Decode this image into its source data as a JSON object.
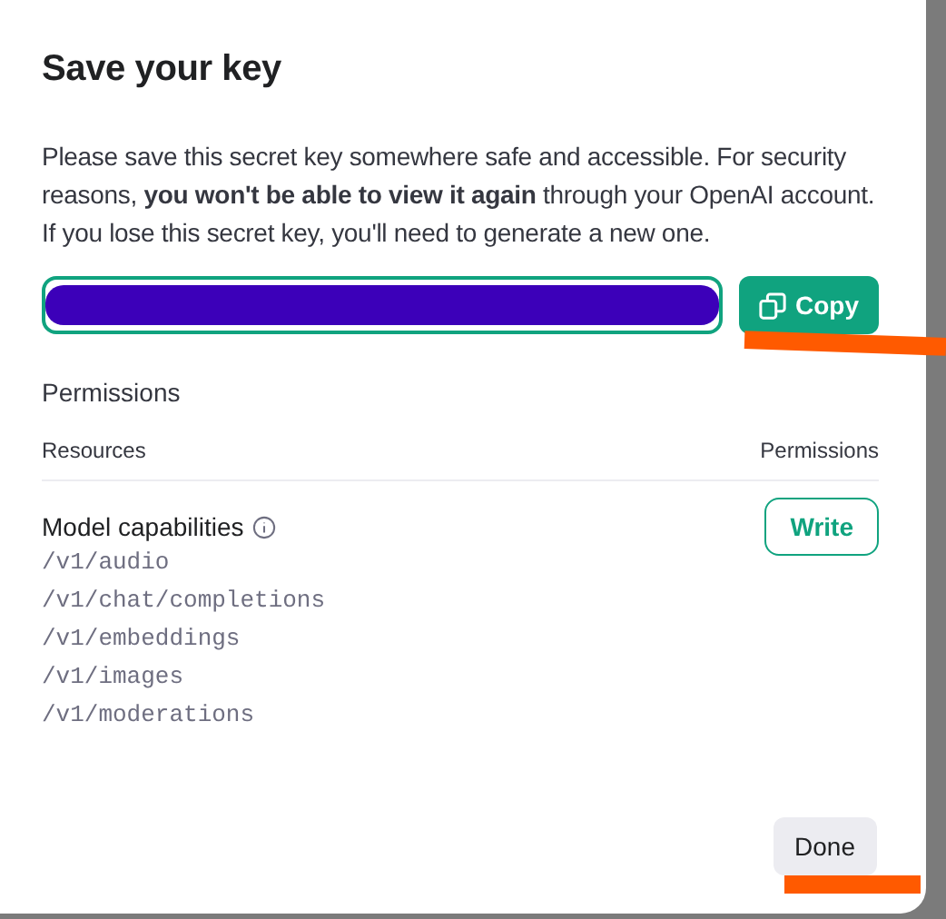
{
  "dialog": {
    "title": "Save your key",
    "message": "Please save this secret key somewhere safe and accessible. For security reasons, **you won't be able to view it again** through your OpenAI account. If you lose this secret key, you'll need to generate a new one.",
    "key_field": {
      "redacted": true
    },
    "copy_button": "Copy"
  },
  "permissions": {
    "heading": "Permissions",
    "columns": [
      "Resources",
      "Permissions"
    ],
    "rows": [
      {
        "name": "Model capabilities",
        "permission": "Write",
        "endpoints": [
          "/v1/audio",
          "/v1/chat/completions",
          "/v1/embeddings",
          "/v1/images",
          "/v1/moderations"
        ]
      }
    ]
  },
  "buttons": [
    "Done"
  ],
  "annotations": [
    {
      "kind": "underline",
      "color": "#ff5a00"
    },
    {
      "kind": "underline",
      "color": "#ff5a00"
    }
  ]
}
